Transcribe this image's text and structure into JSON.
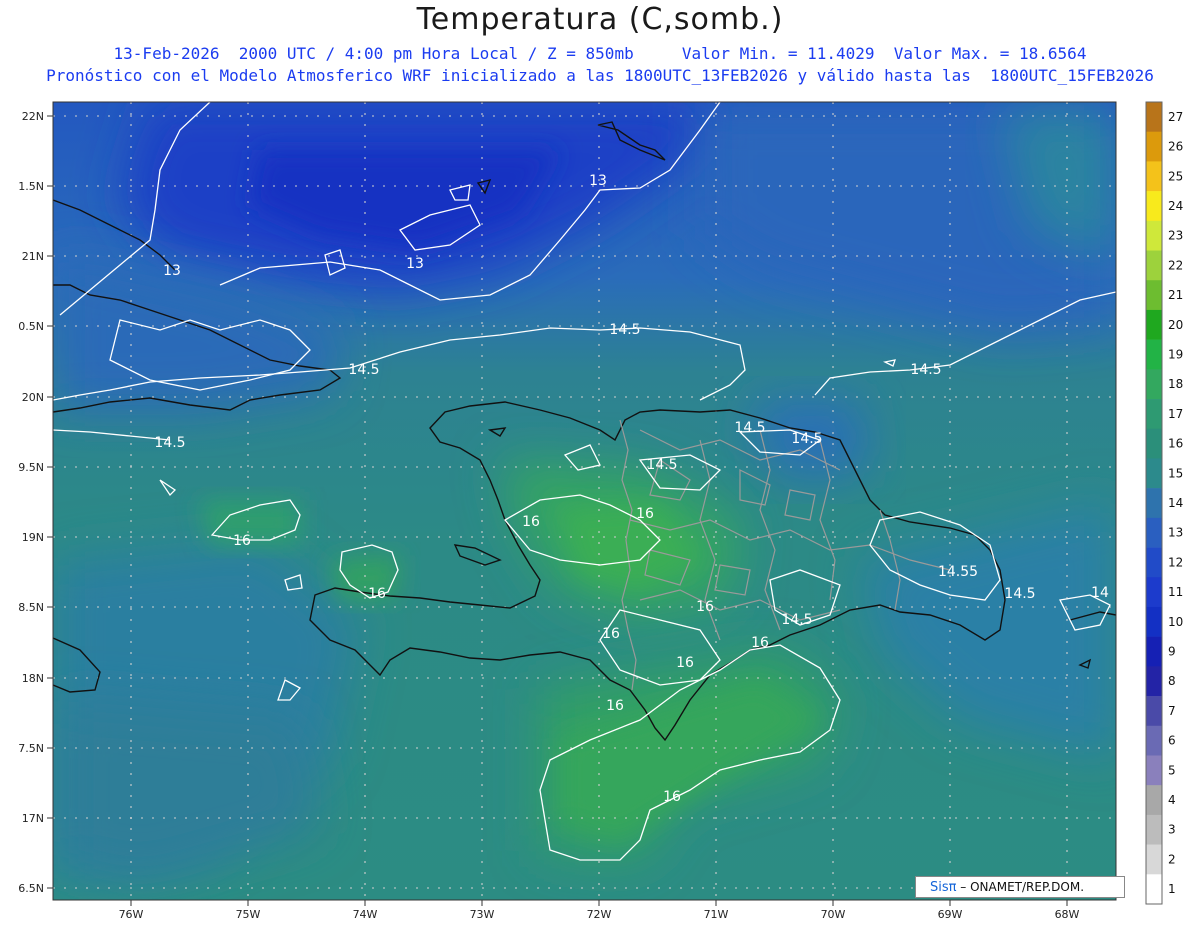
{
  "header": {
    "title": "Temperatura (C,somb.)",
    "subtitle_line1": "13-Feb-2026  2000 UTC / 4:00 pm Hora Local / Z = 850mb     Valor Min. = 11.4029  Valor Max. = 18.6564",
    "subtitle_line2": "Pronóstico con el Modelo Atmosferico WRF inicializado a las 1800UTC_13FEB2026 y válido hasta las  1800UTC_15FEB2026"
  },
  "map": {
    "lat_ticks": [
      "22N",
      "1.5N",
      "21N",
      "0.5N",
      "20N",
      "9.5N",
      "19N",
      "8.5N",
      "18N",
      "7.5N",
      "17N",
      "6.5N"
    ],
    "lon_ticks": [
      "76W",
      "75W",
      "74W",
      "73W",
      "72W",
      "71W",
      "70W",
      "69W",
      "68W"
    ],
    "contour_labels": [
      {
        "text": "13"
      },
      {
        "text": "13"
      },
      {
        "text": "13"
      },
      {
        "text": "14.5"
      },
      {
        "text": "14.5"
      },
      {
        "text": "14.5"
      },
      {
        "text": "14.5"
      },
      {
        "text": "14.5"
      },
      {
        "text": "14.5"
      },
      {
        "text": "14.5"
      },
      {
        "text": "14.55"
      },
      {
        "text": "14.5"
      },
      {
        "text": "14.5"
      },
      {
        "text": "14"
      },
      {
        "text": "16"
      },
      {
        "text": "16"
      },
      {
        "text": "16"
      },
      {
        "text": "16"
      },
      {
        "text": "16"
      },
      {
        "text": "16"
      },
      {
        "text": "16"
      },
      {
        "text": "16"
      },
      {
        "text": "16"
      }
    ]
  },
  "colorbar": {
    "labels": [
      "27",
      "26",
      "25",
      "24",
      "23",
      "22",
      "21",
      "20",
      "19",
      "18",
      "17",
      "16",
      "15",
      "14",
      "13",
      "12",
      "11",
      "10",
      "9",
      "8",
      "7",
      "6",
      "5",
      "4",
      "3",
      "2",
      "1"
    ],
    "colors": [
      "#b8741a",
      "#dc9a0c",
      "#f4c21a",
      "#f8ea1c",
      "#cfe83a",
      "#9dd23c",
      "#6dbd30",
      "#1fa81f",
      "#22b346",
      "#33a85f",
      "#2e9a72",
      "#2b8f7a",
      "#2c8a8c",
      "#2e73ad",
      "#2a5fc0",
      "#214bc8",
      "#1c3bcc",
      "#1330c4",
      "#1520b4",
      "#2323a6",
      "#4a4aa8",
      "#6a6ab4",
      "#8a80bc",
      "#a8a8a8",
      "#bcbcbc",
      "#d8d8d8",
      "#ffffff"
    ]
  },
  "credit": {
    "brand": "Sisπ",
    "text": "– ONAMET/REP.DOM."
  },
  "colors": {
    "title_text": "#1b3cf0",
    "contour": "#ffffff",
    "coast": "#111111",
    "province_border": "#9a9a9a"
  }
}
